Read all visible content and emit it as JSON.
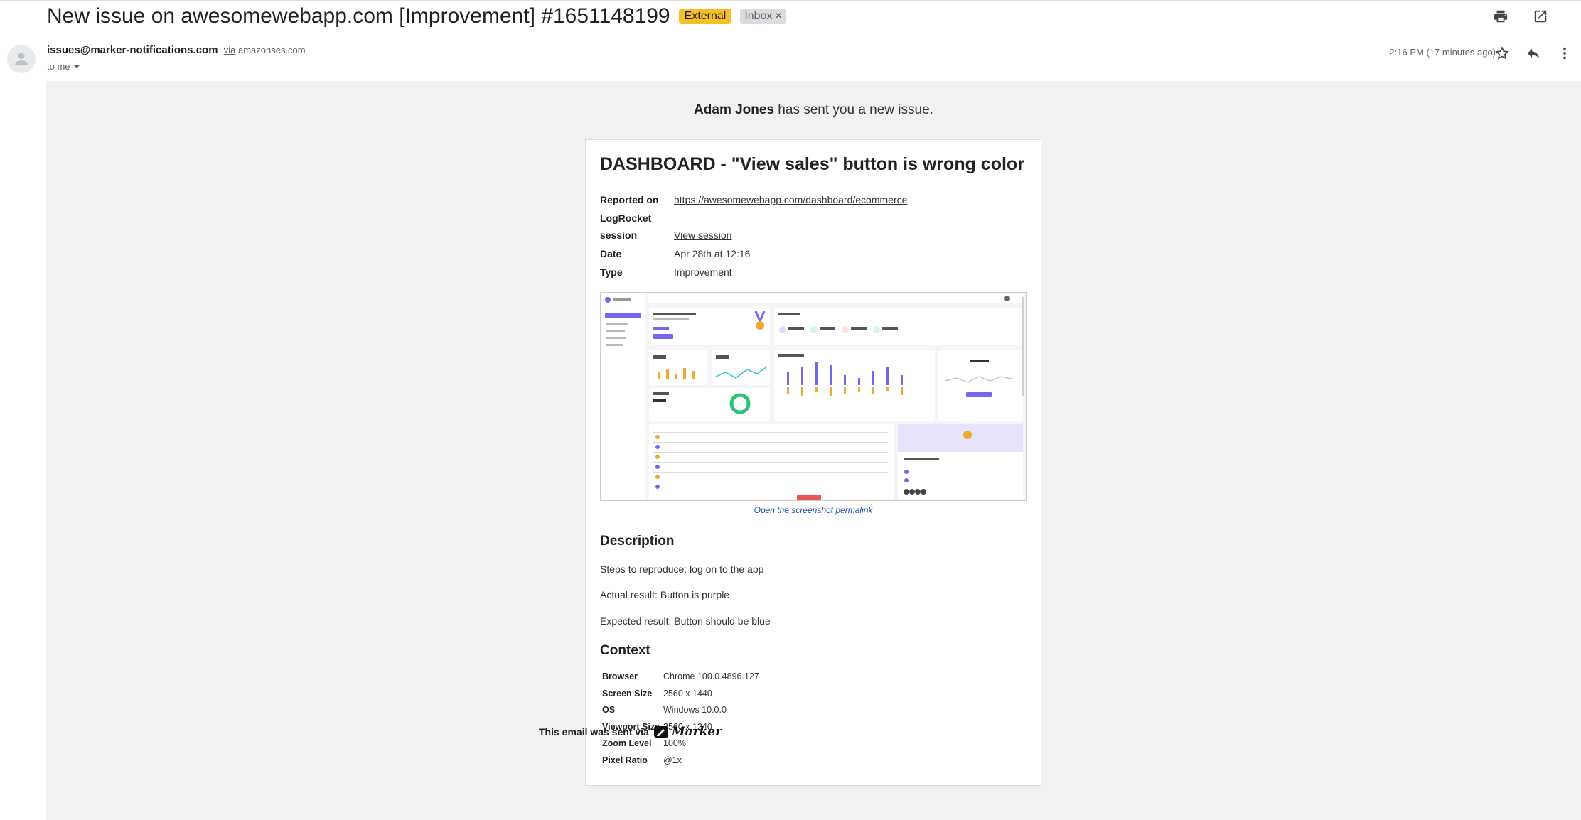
{
  "subject": "New issue on awesomewebapp.com [Improvement] #1651148199",
  "labels": {
    "external": "External",
    "inbox": "Inbox",
    "inbox_remove": "×"
  },
  "sender": {
    "address": "issues@marker-notifications.com",
    "via_word": "via",
    "via_domain": "amazonses.com",
    "to": "to me"
  },
  "timestamp": "2:16 PM (17 minutes ago)",
  "icons": {
    "print": "print-icon",
    "popout": "open-in-new-icon",
    "star": "star-icon",
    "reply": "reply-icon",
    "more": "more-vertical-icon",
    "avatar": "avatar-icon",
    "chevron": "chevron-down-icon"
  },
  "email": {
    "intro_name": "Adam Jones",
    "intro_rest": " has sent you a new issue.",
    "title": "DASHBOARD - \"View sales\" button is wrong color",
    "meta": {
      "reported_on_label": "Reported on",
      "reported_on_value": "https://awesomewebapp.com/dashboard/ecommerce",
      "logrocket_label_1": "LogRocket",
      "logrocket_label_2": "session",
      "logrocket_value": "View session",
      "date_label": "Date",
      "date_value": "Apr 28th at 12:16",
      "type_label": "Type",
      "type_value": "Improvement"
    },
    "screenshot_link": "Open the screenshot permalink",
    "description_heading": "Description",
    "description_lines": [
      "Steps to reproduce: log on to the app",
      "Actual result: Button is purple",
      "Expected result: Button should be blue"
    ],
    "context_heading": "Context",
    "context": [
      {
        "k": "Browser",
        "v": "Chrome 100.0.4896.127"
      },
      {
        "k": "Screen Size",
        "v": "2560 x 1440"
      },
      {
        "k": "OS",
        "v": "Windows 10.0.0"
      },
      {
        "k": "Viewport Size",
        "v": "2560 x 1240"
      },
      {
        "k": "Zoom Level",
        "v": "100%"
      },
      {
        "k": "Pixel Ratio",
        "v": "@1x"
      }
    ],
    "footer_text": "This email was sent via",
    "footer_brand": "Marker"
  },
  "colors": {
    "external_label": "#f6bf26",
    "inbox_label": "#dadce0",
    "email_background": "#f1f1f1",
    "dashboard_accent": "#7367f0",
    "dashboard_orange": "#f0a830"
  }
}
